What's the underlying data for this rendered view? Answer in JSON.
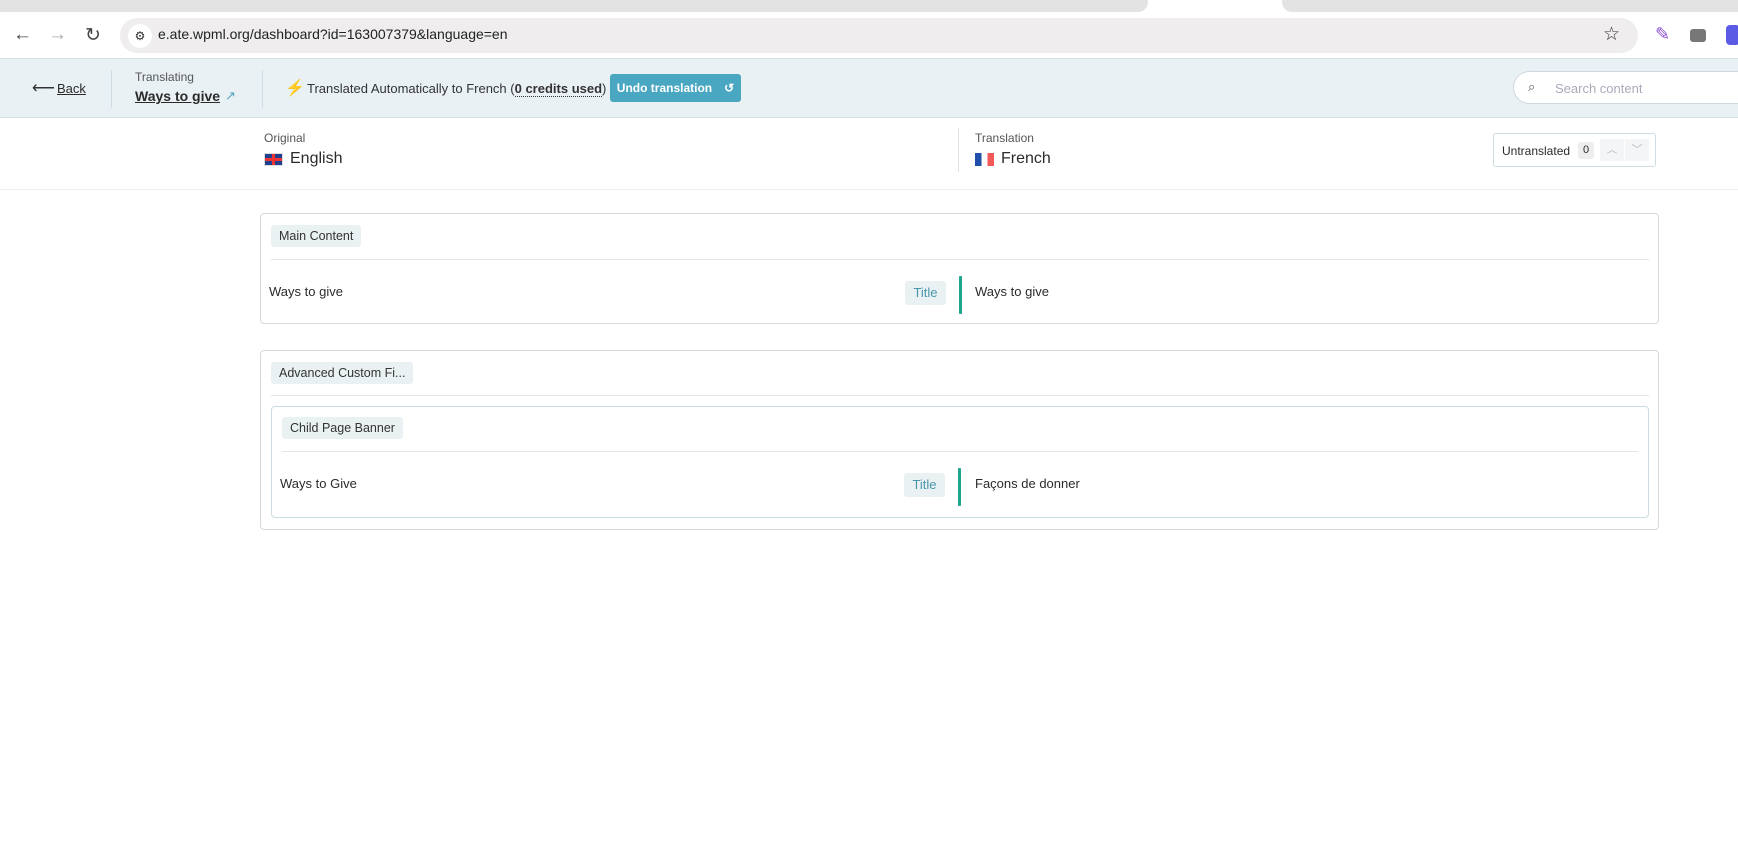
{
  "browser": {
    "url": "e.ate.wpml.org/dashboard?id=163007379&language=en"
  },
  "header": {
    "back": "Back",
    "translating_label": "Translating",
    "page_title": "Ways to give",
    "status_prefix": "Translated Automatically to French (",
    "credits": "0 credits used",
    "status_suffix": ")",
    "undo": "Undo translation",
    "search_placeholder": "Search content"
  },
  "languages": {
    "original_label": "Original",
    "original": "English",
    "translation_label": "Translation",
    "translation": "French",
    "untranslated_label": "Untranslated",
    "untranslated_count": "0"
  },
  "sections": [
    {
      "tag": "Main Content",
      "rows": [
        {
          "source": "Ways to give",
          "type": "Title",
          "target": "Ways to give"
        }
      ]
    },
    {
      "tag": "Advanced Custom Fi...",
      "sub": {
        "tag": "Child Page Banner",
        "rows": [
          {
            "source": "Ways to Give",
            "type": "Title",
            "target": "Façons de donner"
          }
        ]
      }
    }
  ],
  "colors": {
    "accent": "#4aa7c1",
    "done": "#1ea58d",
    "header_bg": "#e9f1f4"
  }
}
